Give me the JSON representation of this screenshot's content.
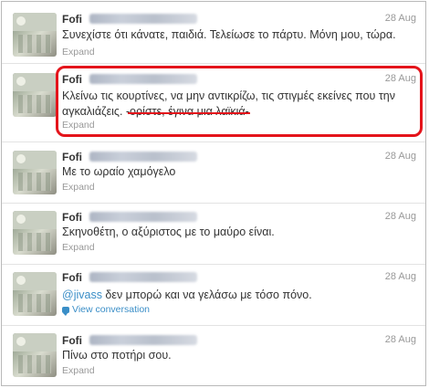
{
  "tweets": [
    {
      "name": "Fofi",
      "date": "28 Aug",
      "text": "Συνεχίστε ότι κάνατε, παιδιά. Τελείωσε το πάρτυ. Μόνη μου, τώρα.",
      "action": "Expand"
    },
    {
      "name": "Fofi",
      "date": "28 Aug",
      "text_line1": "Κλείνω τις κουρτίνες, να μην αντικρίζω, τις στιγμές εκείνες που την",
      "text_line2_plain": "αγκαλιάζεις. ",
      "text_line2_marked": "-ορίστε, έγινα μια λαϊκιά-",
      "action": "Expand"
    },
    {
      "name": "Fofi",
      "date": "28 Aug",
      "text": "Με το ωραίο χαμόγελο",
      "action": "Expand"
    },
    {
      "name": "Fofi",
      "date": "28 Aug",
      "text": "Σκηνοθέτη, ο αξύριστος με το μαύρο είναι.",
      "action": "Expand"
    },
    {
      "name": "Fofi",
      "date": "28 Aug",
      "mention": "@jivass",
      "text": " δεν μπορώ και να γελάσω με τόσο πόνο.",
      "action": "View conversation"
    },
    {
      "name": "Fofi",
      "date": "28 Aug",
      "text": "Πίνω στο ποτήρι σου.",
      "action": "Expand"
    }
  ]
}
